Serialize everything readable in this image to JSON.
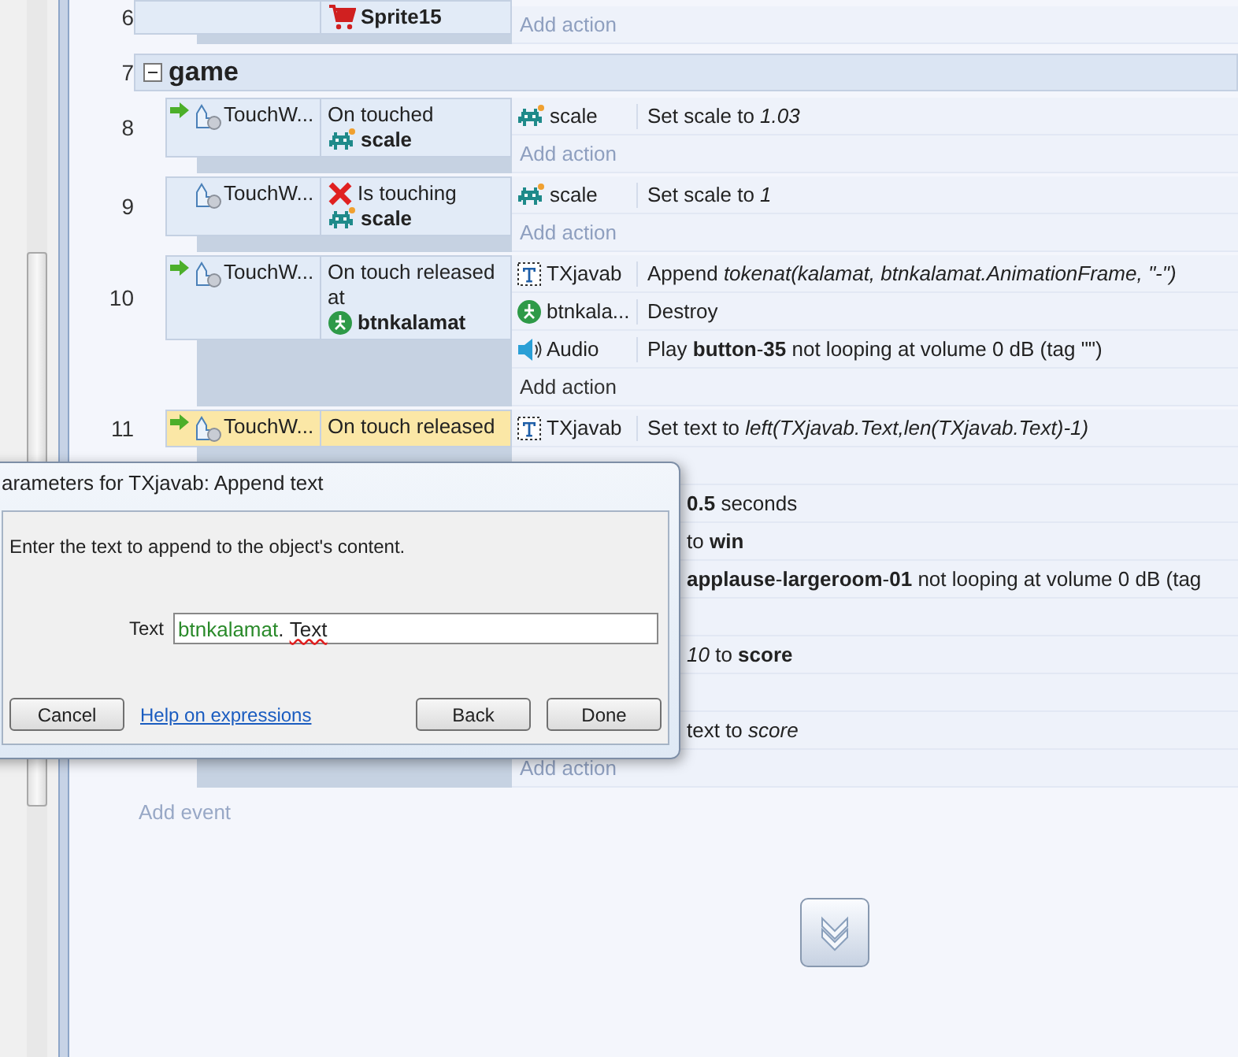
{
  "blocks": [
    {
      "kind": "event",
      "number": "6",
      "conditions": [
        {
          "trigger": false,
          "inverted": false,
          "selected": false,
          "target": {
            "name": "Sprite15",
            "kind": "cart"
          }
        }
      ],
      "add_action": {
        "label": "Add action",
        "highlighted": false
      }
    },
    {
      "kind": "group",
      "number": "7",
      "title": "game",
      "expanded": true,
      "children": [
        {
          "number": "8",
          "conditions": [
            {
              "object": "TouchW...",
              "trigger": true,
              "inverted": false,
              "selected": false,
              "text": "On touched",
              "target": {
                "name": "scale",
                "kind": "invader"
              }
            }
          ],
          "actions": [
            {
              "object": "scale",
              "kind": "invader",
              "text": "Set scale to *1.03*"
            }
          ],
          "add_action": {
            "label": "Add action",
            "highlighted": false
          }
        },
        {
          "number": "9",
          "conditions": [
            {
              "object": "TouchW...",
              "trigger": false,
              "inverted": true,
              "selected": false,
              "text": "Is touching",
              "target": {
                "name": "scale",
                "kind": "invader"
              }
            }
          ],
          "actions": [
            {
              "object": "scale",
              "kind": "invader",
              "text": "Set scale to *1*"
            }
          ],
          "add_action": {
            "label": "Add action",
            "highlighted": false
          }
        },
        {
          "number": "10",
          "conditions": [
            {
              "object": "TouchW...",
              "trigger": true,
              "inverted": false,
              "selected": false,
              "text": "On touch released at",
              "target": {
                "name": "btnkalamat",
                "kind": "button"
              }
            }
          ],
          "actions": [
            {
              "object": "TXjavab",
              "kind": "text",
              "text": "Append *tokenat(kalamat, btnkalamat.AnimationFrame, \"-\")*"
            },
            {
              "object": "btnkala...",
              "kind": "button",
              "text": "Destroy"
            },
            {
              "object": "Audio",
              "kind": "audio",
              "text": "Play **button**-**35** not looping at volume 0 dB (tag \"\")"
            }
          ],
          "add_action": {
            "label": "Add action",
            "highlighted": true
          }
        },
        {
          "number": "11",
          "conditions": [
            {
              "object": "TouchW...",
              "trigger": true,
              "inverted": false,
              "selected": true,
              "text": "On touch released"
            }
          ],
          "actions": [
            {
              "object": "TXjavab",
              "kind": "text",
              "text": "Set text to *left(TXjavab.Text,len(TXjavab.Text)-1)*"
            },
            {
              "kind": "hidden"
            },
            {
              "kind": "covered",
              "text": "**0.5** seconds"
            },
            {
              "kind": "covered",
              "text": "to **win**"
            },
            {
              "kind": "covered",
              "text": "**applause**-**largeroom**-**01** not looping at volume 0 dB (tag"
            },
            {
              "kind": "hidden"
            },
            {
              "kind": "covered",
              "text": "*10* to **score**"
            },
            {
              "kind": "hidden"
            },
            {
              "kind": "covered",
              "text": "text to *score*"
            }
          ],
          "add_action": {
            "label": "Add action",
            "highlighted": false
          }
        }
      ]
    }
  ],
  "add_event": "Add event",
  "dialog": {
    "title": "arameters for TXjavab: Append text",
    "prompt": "Enter the text to append to the object's content.",
    "field_label": "Text",
    "value_parts": [
      {
        "text": "btnkalamat",
        "kind": "object"
      },
      {
        "text": ". ",
        "kind": "plain"
      },
      {
        "text": "Text",
        "kind": "misspelled"
      }
    ],
    "cancel": "Cancel",
    "help_link": "Help on expressions",
    "back": "Back",
    "done": "Done"
  }
}
